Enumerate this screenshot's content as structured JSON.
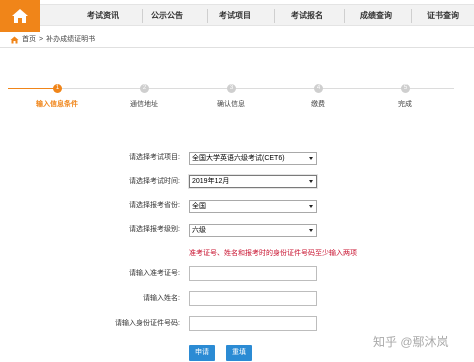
{
  "nav": {
    "items": [
      "考试资讯",
      "公示公告",
      "考试项目",
      "考试报名",
      "成绩查询",
      "证书查询"
    ]
  },
  "breadcrumb": {
    "home": "首页",
    "separator": ">",
    "current": "补办成绩证明书"
  },
  "steps": [
    {
      "number": "1",
      "label": "输入信息条件",
      "active": true
    },
    {
      "number": "2",
      "label": "通信地址",
      "active": false
    },
    {
      "number": "3",
      "label": "确认信息",
      "active": false
    },
    {
      "number": "4",
      "label": "缴费",
      "active": false
    },
    {
      "number": "5",
      "label": "完成",
      "active": false
    }
  ],
  "form": {
    "exam_project_label": "请选择考试项目:",
    "exam_project_value": "全国大学英语六级考试(CET6)",
    "exam_time_label": "请选择考试时间:",
    "exam_time_value": "2019年12月",
    "province_label": "请选择报考省份:",
    "province_value": "全国",
    "level_label": "请选择报考级别:",
    "level_value": "六级",
    "warning": "准考证号、姓名和报考时的身份证件号码至少输入两项",
    "ticket_label": "请输入准考证号:",
    "ticket_value": "",
    "name_label": "请输入姓名:",
    "name_value": "",
    "id_label": "请输入身份证件号码:",
    "id_value": ""
  },
  "buttons": {
    "submit": "申请",
    "reset": "重填"
  },
  "watermark": "知乎 @鄢沐岚",
  "colors": {
    "accent": "#f08519",
    "button": "#2b8bd4",
    "warning": "#c8102e"
  }
}
